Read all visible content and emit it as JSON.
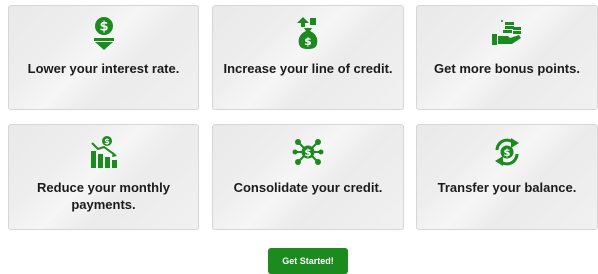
{
  "colors": {
    "accent": "#1b8a1f",
    "card_bg": "#eeeeee",
    "text": "#1b1b1b"
  },
  "cards": [
    {
      "label": "Lower your interest rate.",
      "icon": "dollar-down-arrow-icon"
    },
    {
      "label": "Increase your line of credit.",
      "icon": "money-bag-up-arrow-icon"
    },
    {
      "label": "Get more bonus points.",
      "icon": "hand-coins-icon"
    },
    {
      "label": "Reduce your monthly payments.",
      "icon": "declining-chart-dollar-icon"
    },
    {
      "label": "Consolidate your credit.",
      "icon": "dollar-network-icon"
    },
    {
      "label": "Transfer your balance.",
      "icon": "dollar-transfer-icon"
    }
  ],
  "cta": {
    "label": "Get Started!"
  }
}
